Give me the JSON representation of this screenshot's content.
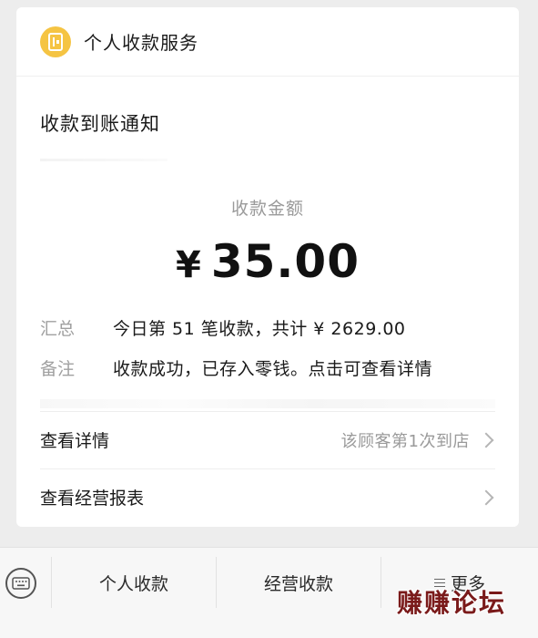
{
  "header": {
    "service_name": "个人收款服务",
    "icon": "wallet-icon"
  },
  "notice": {
    "title": "收款到账通知",
    "amount_label": "收款金额",
    "currency_symbol": "¥",
    "amount": "35.00",
    "summary_label": "汇总",
    "summary_value": "今日第 51 笔收款，共计 ¥ 2629.00",
    "remark_label": "备注",
    "remark_value": "收款成功，已存入零钱。点击可查看详情"
  },
  "links": {
    "details_label": "查看详情",
    "details_hint": "该顾客第1次到店",
    "report_label": "查看经营报表"
  },
  "tabbar": {
    "keyboard_icon": "keyboard-icon",
    "tab1": "个人收款",
    "tab2": "经营收款",
    "tab3": "更多"
  },
  "watermark": "赚赚论坛",
  "colors": {
    "icon_yellow": "#f5c443",
    "watermark": "#7a1a1a"
  }
}
